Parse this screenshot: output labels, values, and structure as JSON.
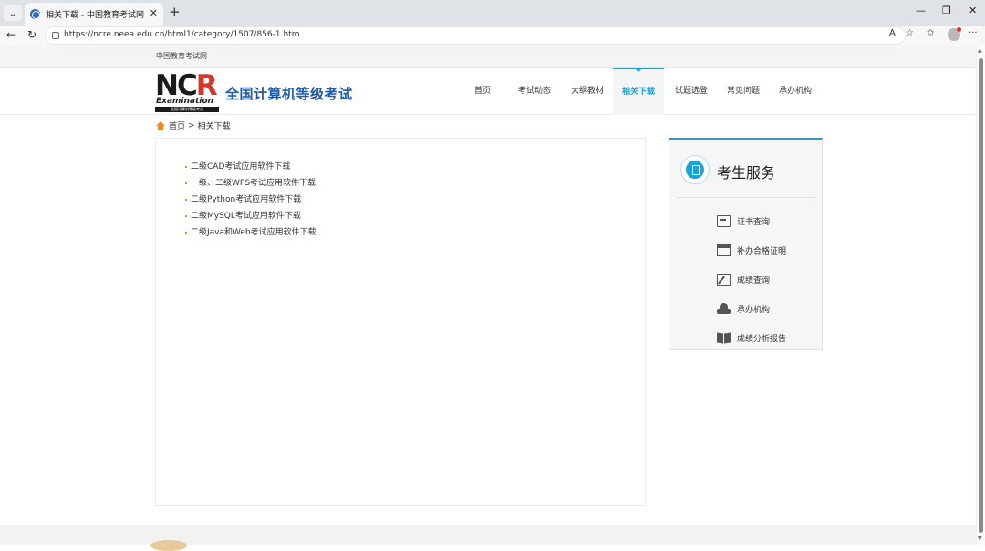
{
  "browser": {
    "tab_title": "相关下载 - 中国教育考试网",
    "url": "https://ncre.neea.edu.cn/html1/category/1507/856-1.htm"
  },
  "site": {
    "top_link": "中国教育考试网",
    "logo_text": "NCR",
    "logo_subtext": "Examination",
    "logo_cn": "全国计算机等级考试",
    "name": "全国计算机等级考试"
  },
  "nav": {
    "items": [
      {
        "label": "首页"
      },
      {
        "label": "考试动态"
      },
      {
        "label": "大纲教材"
      },
      {
        "label": "相关下载"
      },
      {
        "label": "试题选登"
      },
      {
        "label": "常见问题"
      },
      {
        "label": "承办机构"
      }
    ]
  },
  "breadcrumb": {
    "home": "首页",
    "separator": ">",
    "current": "相关下载"
  },
  "downloads": [
    "二级CAD考试应用软件下载",
    "一级、二级WPS考试应用软件下载",
    "二级Python考试应用软件下载",
    "二级MySQL考试应用软件下载",
    "二级Java和Web考试应用软件下载"
  ],
  "service": {
    "title": "考生服务",
    "items": [
      {
        "label": "证书查询",
        "icon": "certificate-icon"
      },
      {
        "label": "补办合格证明",
        "icon": "calendar-icon"
      },
      {
        "label": "成绩查询",
        "icon": "edit-icon"
      },
      {
        "label": "承办机构",
        "icon": "organization-icon"
      },
      {
        "label": "成绩分析报告",
        "icon": "report-book-icon"
      }
    ]
  },
  "colors": {
    "accent": "#1ba3d5",
    "brand_blue": "#1e5aa8",
    "bullet_orange": "#f08a1d"
  }
}
